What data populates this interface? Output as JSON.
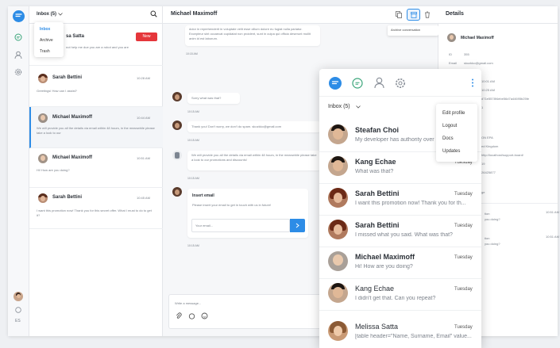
{
  "colors": {
    "accent": "#2d8ce6",
    "danger": "#e5363b"
  },
  "rail": {
    "top_icons": [
      "chat-logo-icon",
      "chat-icon",
      "user-icon",
      "gear-icon"
    ],
    "bottom_label": "ES"
  },
  "list": {
    "header": {
      "label": "Inbox (5)"
    },
    "dropdown": [
      "Inbox",
      "Archive",
      "Trash"
    ],
    "new_badge": "New",
    "partial": {
      "name": "sa Satta",
      "msg": "not help me due you are a robot and you are"
    },
    "rows": [
      {
        "name": "Sarah Bettini",
        "time": "10:28 AM",
        "msg": "Greetings! How can I assist?"
      },
      {
        "name": "Michael Maximoff",
        "time": "10:44 AM",
        "msg": "We will provide you all the details via email within 48 hours, in the meanwhile please take a look to our"
      },
      {
        "name": "Michael Maximoff",
        "time": "10:51 AM",
        "msg": "Hi! How are you doing?"
      },
      {
        "name": "Sarah Bettini",
        "time": "10:45 AM",
        "msg": "I want this promotion now! Thank you for this secret offer. What I must to do to get it?"
      }
    ]
  },
  "chat": {
    "title": "Michael Maximoff",
    "tooltip": "Archive conversation",
    "top_text": "dolor in reprehenderit in voluptate velit esse cillum dolore eu fugiat nulla pariatur. Excepteur sint occaecat cupidatat non proident, sunt in culpa qui officia deserunt mollit anim id est laborum.",
    "top_time": "10:15 AM",
    "m1": {
      "text": "Sorry what was that?",
      "time": "10:15 AM"
    },
    "m2": {
      "text": "Thank you! Don't worry, we don't do spam. skozkko@gmail.com",
      "time": "10:15 AM"
    },
    "m3": {
      "text": "We will provide you all the details via email within 48 hours, in the meanwhile please take a look to our promotions and discounts!",
      "time": "10:15 AM"
    },
    "card": {
      "title": "Insert email",
      "text": "Please insert your email to get in touch with us in future!",
      "placeholder": "Your email...",
      "time": "10:15 AM"
    },
    "composer_placeholder": "Write a message..."
  },
  "details": {
    "title": "Details",
    "name": "Michael Maximoff",
    "id_label": "ID",
    "id_value": "355",
    "email_label": "Email",
    "email_value": "skozkko@gmail.com",
    "lines": [
      "ago",
      "10:01 AM",
      "10:25 AM",
      "d71e5578f4ebe56d7a44695b25fe",
      "1",
      "ON EPA",
      "ed Kingdom",
      "http://localhost/support-board/",
      "19",
      "26425877",
      "ge"
    ],
    "convs": [
      {
        "snippet": "tion",
        "msg": "you doing?",
        "time": "10:51 AM"
      },
      {
        "snippet": "tion",
        "msg": "you doing?",
        "time": "10:51 AM"
      }
    ]
  },
  "mobile": {
    "inbox_label": "Inbox (5)",
    "menu": [
      "Edit profile",
      "Logout",
      "Docs",
      "Updates"
    ],
    "rows": [
      {
        "name": "Steafan Choi",
        "msg": "My developer has authority over",
        "time": ""
      },
      {
        "name": "Kang Echae",
        "msg": "What was that?",
        "time": "Tuesday"
      },
      {
        "name": "Sarah Bettini",
        "msg": "I want this promotion now! Thank you for th...",
        "time": "Tuesday"
      },
      {
        "name": "Sarah Bettini",
        "msg": "I missed what you said. What was that?",
        "time": "Tuesday"
      },
      {
        "name": "Michael Maximoff",
        "msg": "Hi! How are you doing?",
        "time": "Tuesday"
      },
      {
        "name": "Kang Echae",
        "msg": "I didn't get that. Can you repeat?",
        "time": "Tuesday"
      },
      {
        "name": "Melissa Satta",
        "msg": "[table header=\"Name, Surname, Email\" value...",
        "time": "Tuesday"
      }
    ]
  }
}
